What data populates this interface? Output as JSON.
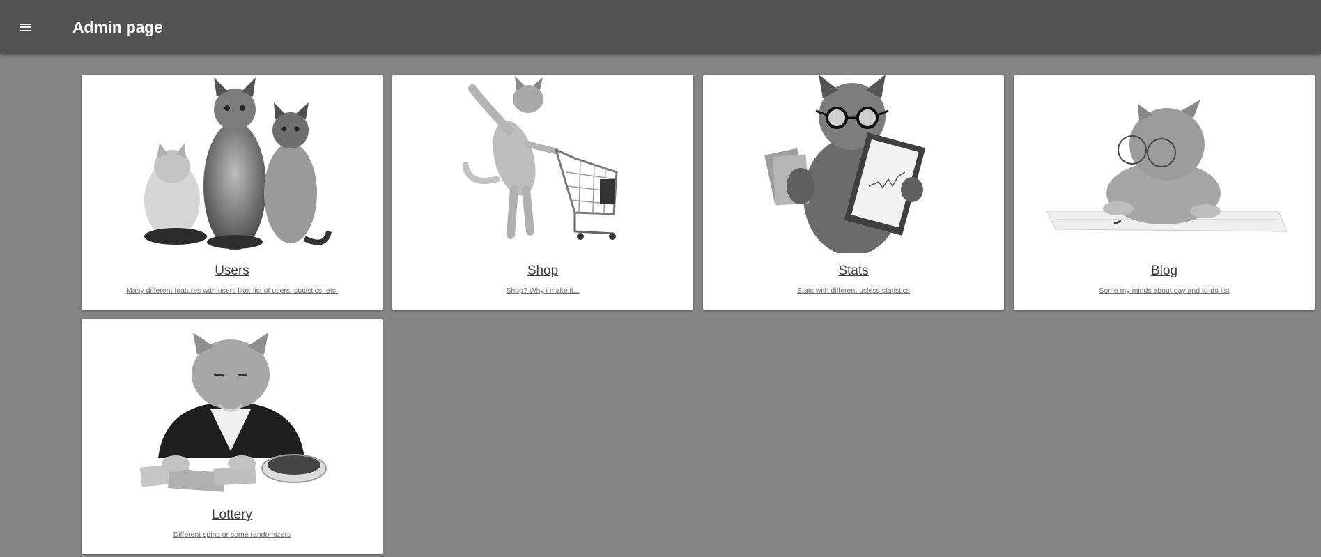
{
  "header": {
    "title": "Admin page",
    "menu_icon": "hamburger-menu-icon"
  },
  "cards": [
    {
      "title": "Users",
      "description": "Many different features with users like: list of users, statistics, etc.",
      "image": "three-cats-image"
    },
    {
      "title": "Shop",
      "description": "Shop? Why i make it...",
      "image": "cat-with-shopping-cart-image"
    },
    {
      "title": "Stats",
      "description": "Stats with different usless statistics",
      "image": "cat-with-glasses-and-clipboard-image"
    },
    {
      "title": "Blog",
      "description": "Some my minds about day and to-do list",
      "image": "kitten-with-glasses-reading-image"
    },
    {
      "title": "Lottery",
      "description": "Different spins or some randomizers",
      "image": "rich-cat-with-money-image"
    }
  ]
}
